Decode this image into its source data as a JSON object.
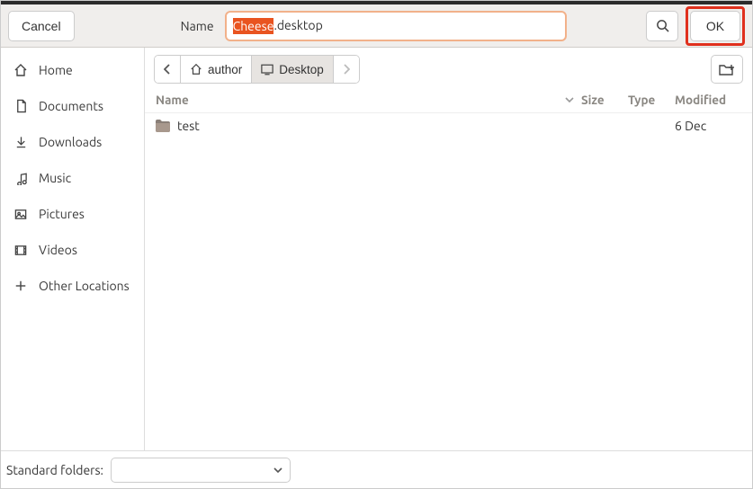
{
  "header": {
    "cancel_label": "Cancel",
    "name_label": "Name",
    "filename_selected": "Cheese",
    "filename_rest": ".desktop",
    "ok_label": "OK"
  },
  "sidebar": {
    "items": [
      {
        "icon": "home-icon",
        "label": "Home"
      },
      {
        "icon": "documents-icon",
        "label": "Documents"
      },
      {
        "icon": "downloads-icon",
        "label": "Downloads"
      },
      {
        "icon": "music-icon",
        "label": "Music"
      },
      {
        "icon": "pictures-icon",
        "label": "Pictures"
      },
      {
        "icon": "videos-icon",
        "label": "Videos"
      },
      {
        "icon": "plus-icon",
        "label": "Other Locations"
      }
    ]
  },
  "path": {
    "segments": [
      {
        "icon": "home-icon",
        "label": "author",
        "active": false
      },
      {
        "icon": "desktop-icon",
        "label": "Desktop",
        "active": true
      }
    ]
  },
  "columns": {
    "name": "Name",
    "size": "Size",
    "type": "Type",
    "modified": "Modified"
  },
  "rows": [
    {
      "icon": "folder-icon",
      "name": "test",
      "size": "",
      "type": "",
      "modified": "6 Dec"
    }
  ],
  "footer": {
    "label": "Standard folders:",
    "selected": ""
  }
}
